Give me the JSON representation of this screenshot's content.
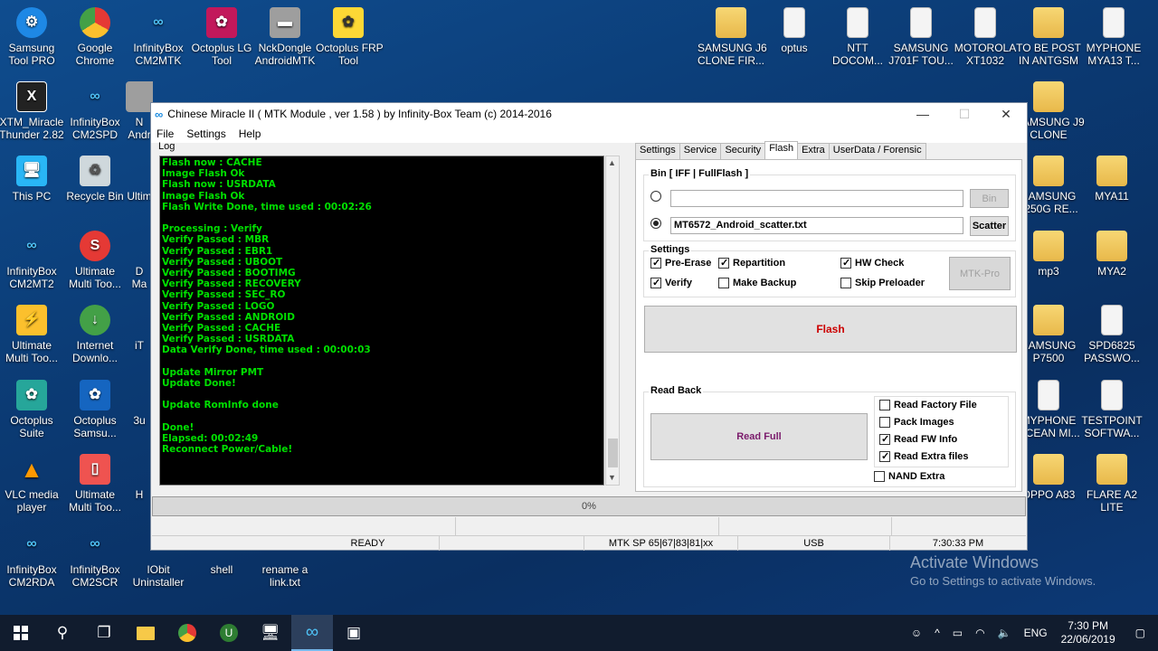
{
  "desktop": {
    "left_icons": [
      {
        "label": "Samsung\nTool PRO"
      },
      {
        "label": "Google\nChrome"
      },
      {
        "label": "InfinityBox\nCM2MTK"
      },
      {
        "label": "Octoplus LG\nTool"
      },
      {
        "label": "NckDongle\nAndroidMTK"
      },
      {
        "label": "Octoplus FRP\nTool"
      },
      {
        "label": "XTM_Miracle\nThunder 2.82"
      },
      {
        "label": "InfinityBox\nCM2SPD"
      },
      {
        "label": "N\nAndr"
      },
      {
        "label": "This PC"
      },
      {
        "label": "Recycle Bin"
      },
      {
        "label": "Ultim"
      },
      {
        "label": "InfinityBox\nCM2MT2"
      },
      {
        "label": "Ultimate\nMulti Too..."
      },
      {
        "label": "D\nMa"
      },
      {
        "label": "Ultimate\nMulti Too..."
      },
      {
        "label": "Internet\nDownlo..."
      },
      {
        "label": "iT"
      },
      {
        "label": "Octoplus\nSuite"
      },
      {
        "label": "Octoplus\nSamsu..."
      },
      {
        "label": "3u"
      },
      {
        "label": "VLC media\nplayer"
      },
      {
        "label": "Ultimate\nMulti Too..."
      },
      {
        "label": "H"
      },
      {
        "label": "InfinityBox\nCM2RDA"
      },
      {
        "label": "InfinityBox\nCM2SCR"
      },
      {
        "label": "IObit\nUninstaller"
      },
      {
        "label": "shell"
      },
      {
        "label": "rename a\nlink.txt"
      }
    ],
    "right_icons": [
      {
        "label": "SAMSUNG J6\nCLONE FIR..."
      },
      {
        "label": "optus"
      },
      {
        "label": "NTT\nDOCOM..."
      },
      {
        "label": "SAMSUNG\nJ701F TOU..."
      },
      {
        "label": "MOTOROLA\nXT1032"
      },
      {
        "label": "TO BE POST\nIN ANTGSM"
      },
      {
        "label": "MYPHONE\nMYA13 T..."
      },
      {
        "label": "SAMSUNG J9\nCLONE"
      },
      {
        "label": "SAMSUNG\nJ250G RE..."
      },
      {
        "label": "MYA11"
      },
      {
        "label": "mp3"
      },
      {
        "label": "MYA2"
      },
      {
        "label": "SAMSUNG\nP7500"
      },
      {
        "label": "SPD6825\nPASSWO..."
      },
      {
        "label": "MYPHONE\nOCEAN MI..."
      },
      {
        "label": "TESTPOINT\nSOFTWA..."
      },
      {
        "label": "OPPO A83"
      },
      {
        "label": "FLARE A2\nLITE"
      }
    ]
  },
  "window": {
    "title": "Chinese Miracle II ( MTK Module , ver 1.58 ) by Infinity-Box Team (c) 2014-2016",
    "minimize": "—",
    "maximize": "☐",
    "close": "✕",
    "menu": [
      "File",
      "Settings",
      "Help"
    ],
    "log_label": "Log",
    "log_text": "Flash now : CACHE\nImage Flash Ok\nFlash now : USRDATA\nImage Flash Ok\nFlash Write Done, time used : 00:02:26\n\nProcessing : Verify\nVerify Passed : MBR\nVerify Passed : EBR1\nVerify Passed : UBOOT\nVerify Passed : BOOTIMG\nVerify Passed : RECOVERY\nVerify Passed : SEC_RO\nVerify Passed : LOGO\nVerify Passed : ANDROID\nVerify Passed : CACHE\nVerify Passed : USRDATA\nData Verify Done, time used : 00:00:03\n\nUpdate Mirror PMT\nUpdate Done!\n\nUpdate RomInfo done\n\nDone!\nElapsed: 00:02:49\nReconnect Power/Cable!",
    "tabs": [
      "Settings",
      "Service",
      "Security",
      "Flash",
      "Extra",
      "UserData / Forensic"
    ],
    "selected_tab": "Flash",
    "bin_group_label": "Bin  [ IFF | FullFlash ]",
    "bin_path": "",
    "bin_button": "Bin",
    "scatter_path": "MT6572_Android_scatter.txt",
    "scatter_button": "Scatter",
    "settings_label": "Settings",
    "checks": [
      {
        "label": "Pre-Erase",
        "checked": true
      },
      {
        "label": "Repartition",
        "checked": true
      },
      {
        "label": "HW Check",
        "checked": true
      },
      {
        "label": "Verify",
        "checked": true
      },
      {
        "label": "Make Backup",
        "checked": false
      },
      {
        "label": "Skip Preloader",
        "checked": false
      }
    ],
    "mtk_pro_button": "MTK-Pro",
    "flash_button": "Flash",
    "readback_label": "Read Back",
    "read_full_button": "Read Full",
    "read_checks": [
      {
        "label": "Read Factory File",
        "checked": false
      },
      {
        "label": "Pack Images",
        "checked": false
      },
      {
        "label": "Read FW Info",
        "checked": true
      },
      {
        "label": "Read Extra files",
        "checked": true
      }
    ],
    "nand_extra": {
      "label": "NAND Extra",
      "checked": false
    },
    "progress_text": "0%",
    "progress_value": 0,
    "status": {
      "state": "READY",
      "chip": "MTK SP 65|67|83|81|xx",
      "port": "USB",
      "time": "7:30:33 PM"
    }
  },
  "watermark": {
    "line1": "Activate Windows",
    "line2": "Go to Settings to activate Windows."
  },
  "taskbar": {
    "lang": "ENG",
    "clock_time": "7:30 PM",
    "clock_date": "22/06/2019"
  },
  "colors": {
    "log_text": "#00e000",
    "flash_button_text": "#cc0000",
    "read_full_text": "#7a1a6b"
  }
}
